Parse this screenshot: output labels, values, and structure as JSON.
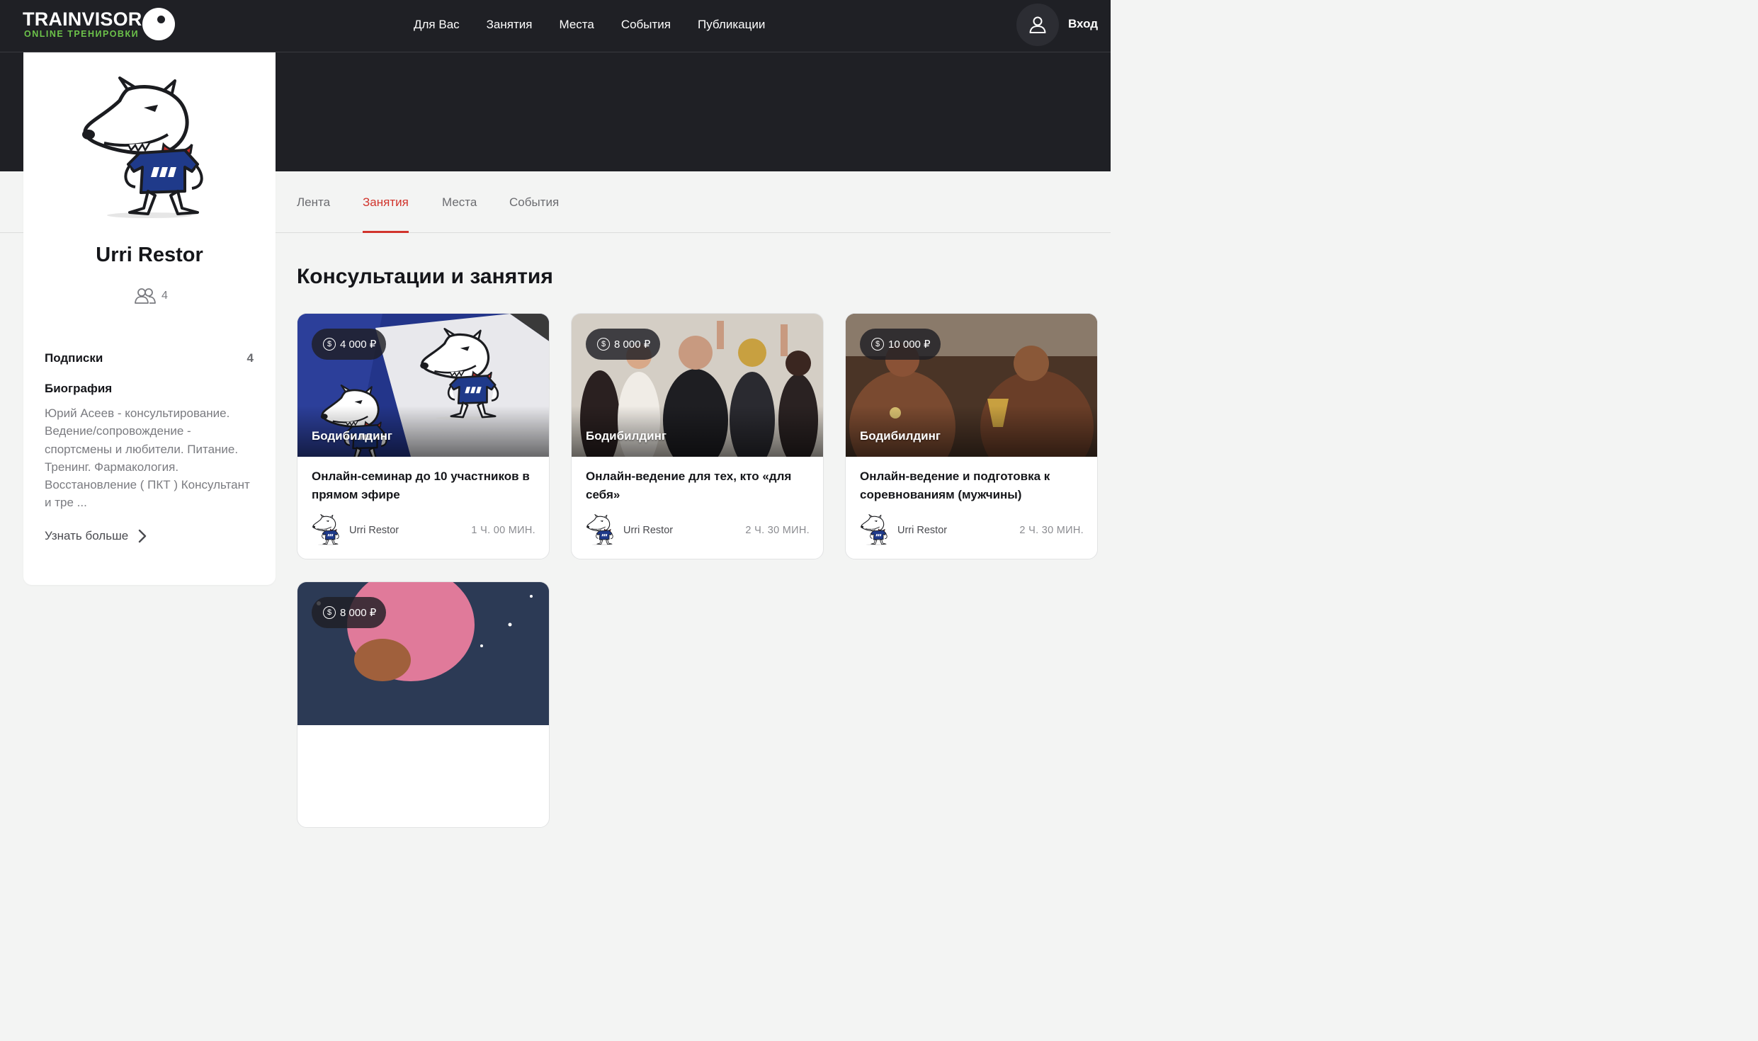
{
  "header": {
    "logo_main": "TRAINVISOR",
    "logo_sub": "ONLINE ТРЕНИРОВКИ",
    "nav": [
      {
        "label": "Для Вас"
      },
      {
        "label": "Занятия"
      },
      {
        "label": "Места"
      },
      {
        "label": "События"
      },
      {
        "label": "Публикации"
      }
    ],
    "login": "Вход"
  },
  "profile": {
    "name": "Urri Restor",
    "followers": "4",
    "subscriptions_label": "Подписки",
    "subscriptions_count": "4",
    "bio_label": "Биография",
    "bio_text": "Юрий Асеев - консультирование. Ведение/сопровождение - спортсмены и любители. Питание. Тренинг. Фармакология. Восстановление ( ПКТ ) Консультант и тре ...",
    "more_link": "Узнать больше"
  },
  "tabs": [
    {
      "label": "Лента",
      "active": false
    },
    {
      "label": "Занятия",
      "active": true
    },
    {
      "label": "Места",
      "active": false
    },
    {
      "label": "События",
      "active": false
    }
  ],
  "section_title": "Консультации и занятия",
  "cards": [
    {
      "price": "4 000 ₽",
      "category": "Бодибилдинг",
      "title": "Онлайн-семинар до 10 участников в прямом эфире",
      "author": "Urri Restor",
      "duration": "1 Ч. 00 МИН."
    },
    {
      "price": "8 000 ₽",
      "category": "Бодибилдинг",
      "title": "Онлайн-ведение для тех, кто «для себя»",
      "author": "Urri Restor",
      "duration": "2 Ч. 30 МИН."
    },
    {
      "price": "10 000 ₽",
      "category": "Бодибилдинг",
      "title": "Онлайн-ведение и подготовка к соревнованиям (мужчины)",
      "author": "Urri Restor",
      "duration": "2 Ч. 30 МИН."
    },
    {
      "price": "8 000 ₽"
    }
  ],
  "colors": {
    "topbar": "#1f2025",
    "accent_red": "#d1342c",
    "logo_green": "#6cc24a",
    "background": "#f3f4f3"
  }
}
